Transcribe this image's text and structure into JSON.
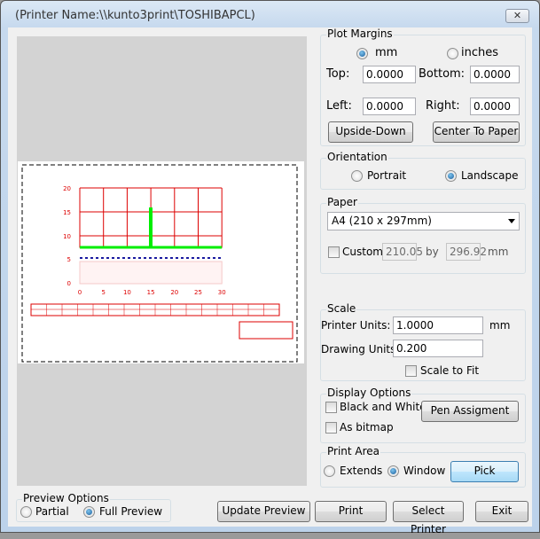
{
  "window": {
    "title": "(Printer Name:\\\\kunto3print\\TOSHIBAPCL)",
    "close_icon": "close-icon"
  },
  "plot_margins": {
    "label": "Plot Margins",
    "units": [
      {
        "label": "mm",
        "selected": true
      },
      {
        "label": "inches",
        "selected": false
      }
    ],
    "top_label": "Top:",
    "top": "0.0000",
    "bottom_label": "Bottom:",
    "bottom": "0.0000",
    "left_label": "Left:",
    "left": "0.0000",
    "right_label": "Right:",
    "right": "0.0000",
    "upside_down": "Upside-Down",
    "center_to_paper": "Center To Paper"
  },
  "orientation": {
    "label": "Orientation",
    "portrait": "Portrait",
    "landscape": "Landscape",
    "selected": "Landscape"
  },
  "paper": {
    "label": "Paper",
    "size": "A4 (210 x 297mm)",
    "custom_label": "Custom",
    "custom_checked": false,
    "width": "210.05",
    "by": "by",
    "height": "296.92",
    "unit": "mm"
  },
  "scale": {
    "label": "Scale",
    "printer_units_label": "Printer Units:",
    "printer_units": "1.0000",
    "printer_unit": "mm",
    "drawing_units_label": "Drawing Units:",
    "drawing_units": "0.200",
    "scale_to_fit": "Scale to Fit",
    "scale_to_fit_checked": false
  },
  "display_options": {
    "label": "Display Options",
    "black_white": "Black and White",
    "black_white_checked": false,
    "as_bitmap": "As bitmap",
    "as_bitmap_checked": false,
    "pen_assignment": "Pen Assigment"
  },
  "print_area": {
    "label": "Print Area",
    "extends": "Extends",
    "window": "Window",
    "selected": "Window",
    "pick": "Pick"
  },
  "preview_options": {
    "label": "Preview Options",
    "partial": "Partial",
    "full": "Full Preview",
    "selected": "Full Preview"
  },
  "buttons": {
    "update_preview": "Update Preview",
    "print": "Print",
    "select_printer": "Select Printer",
    "exit": "Exit"
  },
  "preview": {
    "x_ticks": [
      "0",
      "5",
      "10",
      "15",
      "20",
      "25",
      "30"
    ],
    "y_ticks": [
      "20",
      "15",
      "10",
      "5",
      "0"
    ],
    "colors": {
      "grid": "#dd0000",
      "bar": "#00ee00",
      "dash": "#1a1aa0"
    }
  }
}
